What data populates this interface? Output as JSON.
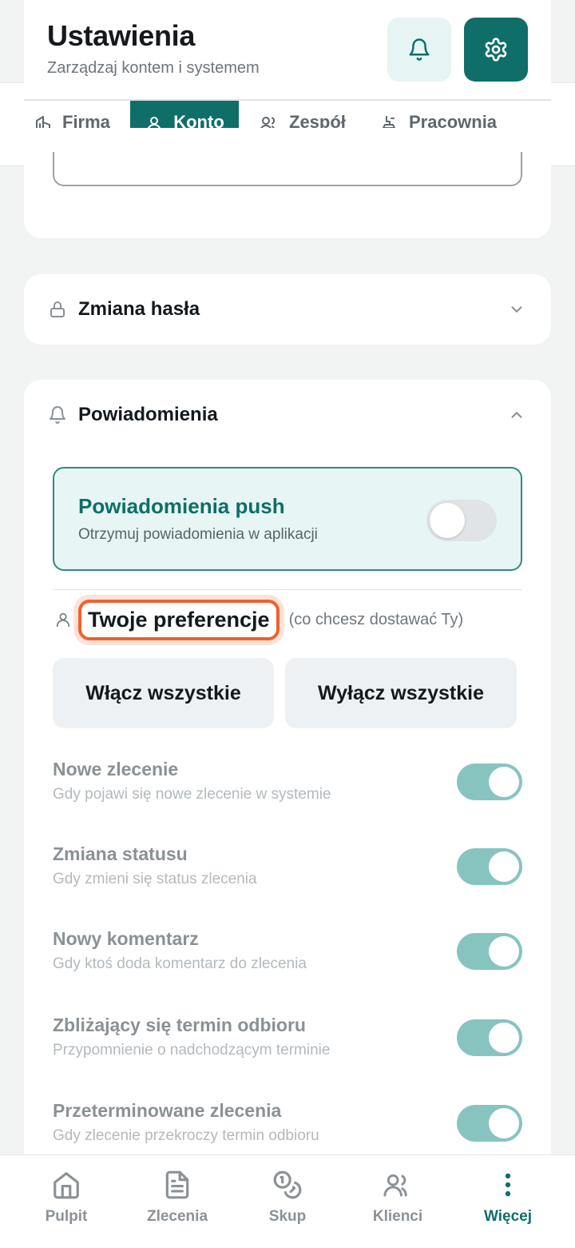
{
  "header": {
    "title": "Ustawienia",
    "subtitle": "Zarządzaj kontem i systemem",
    "bell_icon": "bell-icon",
    "settings_icon": "gear-icon"
  },
  "tabs": [
    {
      "label": "Firma",
      "icon": "building-icon",
      "active": false
    },
    {
      "label": "Konto",
      "icon": "user-icon",
      "active": true
    },
    {
      "label": "Zespół",
      "icon": "users-icon",
      "active": false
    },
    {
      "label": "Pracownia",
      "icon": "workbench-icon",
      "active": false
    }
  ],
  "password_section": {
    "label": "Zmiana hasła",
    "icon": "lock-icon",
    "expanded": false
  },
  "notifications_section": {
    "label": "Powiadomienia",
    "icon": "bell-icon",
    "expanded": true,
    "push": {
      "title": "Powiadomienia push",
      "subtitle": "Otrzymuj powiadomienia w aplikacji",
      "enabled": false
    },
    "preferences": {
      "title": "Twoje preferencje",
      "note": "(co chcesz dostawać Ty)"
    },
    "enable_all": "Włącz wszystkie",
    "disable_all": "Wyłącz wszystkie",
    "options": [
      {
        "title": "Nowe zlecenie",
        "description": "Gdy pojawi się nowe zlecenie w systemie",
        "enabled": true
      },
      {
        "title": "Zmiana statusu",
        "description": "Gdy zmieni się status zlecenia",
        "enabled": true
      },
      {
        "title": "Nowy komentarz",
        "description": "Gdy ktoś doda komentarz do zlecenia",
        "enabled": true
      },
      {
        "title": "Zbliżający się termin odbioru",
        "description": "Przypomnienie o nadchodzącym terminie",
        "enabled": true
      },
      {
        "title": "Przeterminowane zlecenia",
        "description": "Gdy zlecenie przekroczy termin odbioru",
        "enabled": true
      }
    ]
  },
  "bottom_nav": [
    {
      "label": "Pulpit",
      "icon": "home-icon",
      "active": false
    },
    {
      "label": "Zlecenia",
      "icon": "document-icon",
      "active": false
    },
    {
      "label": "Skup",
      "icon": "coins-icon",
      "active": false
    },
    {
      "label": "Klienci",
      "icon": "users-icon",
      "active": false
    },
    {
      "label": "Więcej",
      "icon": "more-vertical-icon",
      "active": true
    }
  ],
  "colors": {
    "accent": "#0f6e68",
    "accent_light": "#e6f5f4",
    "highlight": "#f0602c",
    "toggle_on": "#87c4c0"
  }
}
